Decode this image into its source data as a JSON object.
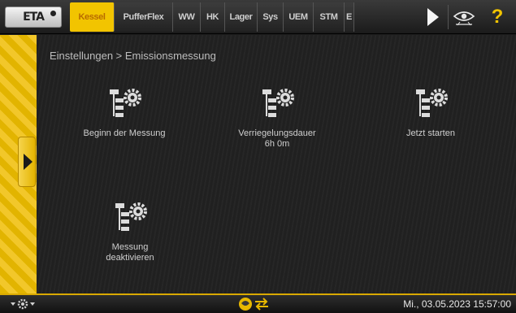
{
  "header": {
    "logo_text": "ETA",
    "tabs": [
      {
        "label": "Kessel",
        "active": true
      },
      {
        "label": "PufferFlex",
        "active": false
      },
      {
        "label": "WW",
        "active": false
      },
      {
        "label": "HK",
        "active": false
      },
      {
        "label": "Lager",
        "active": false
      },
      {
        "label": "Sys",
        "active": false
      },
      {
        "label": "UEM",
        "active": false
      },
      {
        "label": "STM",
        "active": false
      },
      {
        "label": "E",
        "active": false
      }
    ],
    "help_label": "?"
  },
  "breadcrumb": "Einstellungen > Emissionsmessung",
  "items": [
    {
      "line1": "Beginn der Messung",
      "line2": ""
    },
    {
      "line1": "Verriegelungsdauer",
      "line2": "6h 0m"
    },
    {
      "line1": "Jetzt starten",
      "line2": ""
    },
    {
      "line1": "Messung",
      "line2": "deaktivieren"
    }
  ],
  "status": {
    "datetime": "Mi., 03.05.2023 15:57:00"
  },
  "icons": {
    "logo": "eta-logo-icon",
    "next": "next-arrow-icon",
    "eye": "eye-view-icon",
    "help": "help-icon",
    "side": "expand-panel-icon",
    "settings": "tree-gear-icon",
    "menu": "gear-menu-icon",
    "status": "connection-status-icon"
  },
  "colors": {
    "accent": "#f2c400",
    "active_tab_text": "#b86b00",
    "background": "#202020"
  }
}
